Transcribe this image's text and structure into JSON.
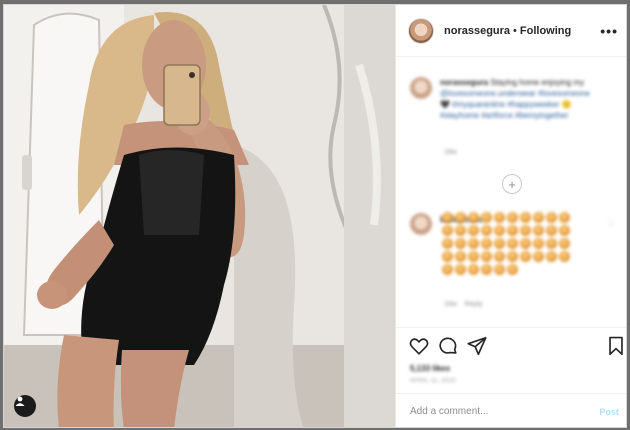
{
  "header": {
    "username": "norassegura",
    "separator": "•",
    "follow_status": "Following",
    "more_label": "•••"
  },
  "caption": {
    "username": "norassegura",
    "text": "Staying home enjoying my",
    "mention": "@lovesomeone.underwear",
    "hashtags": "#lovesomeone 🖤 #myquarantine #happyweeker 🙂 #stayhome #artforce #bemytogether",
    "time": "18w"
  },
  "load_more_label": "+",
  "comment": {
    "username": "baileyloves",
    "time": "16w",
    "reply_label": "Reply",
    "like_label": "♡",
    "emoji_count": 46
  },
  "actions": {
    "likes": "5,133 likes",
    "timestamp": "APRIL 11, 2020"
  },
  "add_comment": {
    "placeholder": "Add a comment...",
    "post_label": "Post"
  },
  "icons": [
    "heart-icon",
    "comment-icon",
    "share-icon",
    "bookmark-icon",
    "user-tag-icon",
    "more-options-icon"
  ]
}
